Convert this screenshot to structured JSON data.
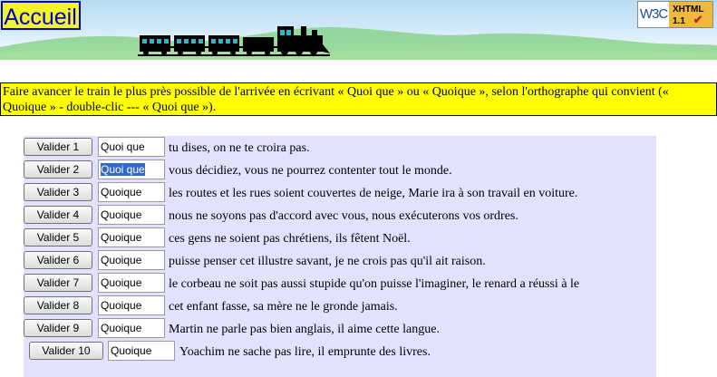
{
  "header": {
    "home_link": "Accueil",
    "badge_left": "W3C",
    "badge_right_line1": "XHTML",
    "badge_right_line2": "1.1",
    "badge_check": "✔"
  },
  "instructions": "Faire avancer le train le plus près possible de l'arrivée en écrivant « Quoi que » ou « Quoique », selon l'orthographe qui convient (« Quoique » - double-clic --- « Quoi que »).",
  "rows": [
    {
      "button": "Valider 1",
      "answer": "Quoi que",
      "sentence": "tu dises, on ne te croira pas."
    },
    {
      "button": "Valider 2",
      "answer": "Quoi que",
      "sentence": "vous décidiez, vous ne pourrez contenter tout le monde."
    },
    {
      "button": "Valider 3",
      "answer": "Quoique",
      "sentence": "les routes et les rues soient couvertes de neige, Marie ira à son travail en voiture."
    },
    {
      "button": "Valider 4",
      "answer": "Quoique",
      "sentence": "nous ne soyons pas d'accord avec vous, nous exécuterons vos ordres."
    },
    {
      "button": "Valider 5",
      "answer": "Quoique",
      "sentence": "ces gens ne soient pas chrétiens, ils fêtent Noël."
    },
    {
      "button": "Valider 6",
      "answer": "Quoique",
      "sentence": "puisse penser cet illustre savant, je ne crois pas qu'il ait raison."
    },
    {
      "button": "Valider 7",
      "answer": "Quoique",
      "sentence": "le corbeau ne soit pas aussi stupide qu'on puisse l'imaginer, le renard a réussi à le"
    },
    {
      "button": "Valider 8",
      "answer": "Quoique",
      "sentence": "cet enfant fasse, sa mère ne le gronde jamais."
    },
    {
      "button": "Valider 9",
      "answer": "Quoique",
      "sentence": "Martin ne parle pas bien anglais, il aime cette langue."
    },
    {
      "button": "Valider 10",
      "answer": "Quoique",
      "sentence": "Yoachim ne sache pas lire, il emprunte des livres."
    }
  ],
  "colors": {
    "instructions_bg": "#ffff00",
    "exercise_bg": "#e2e2ff",
    "home_link_bg": "#f3f32a",
    "home_link_text": "#0000cc",
    "selection": "#3169c6"
  },
  "icons": [
    "train-image",
    "w3c-xhtml-badge",
    "hills-decoration"
  ]
}
